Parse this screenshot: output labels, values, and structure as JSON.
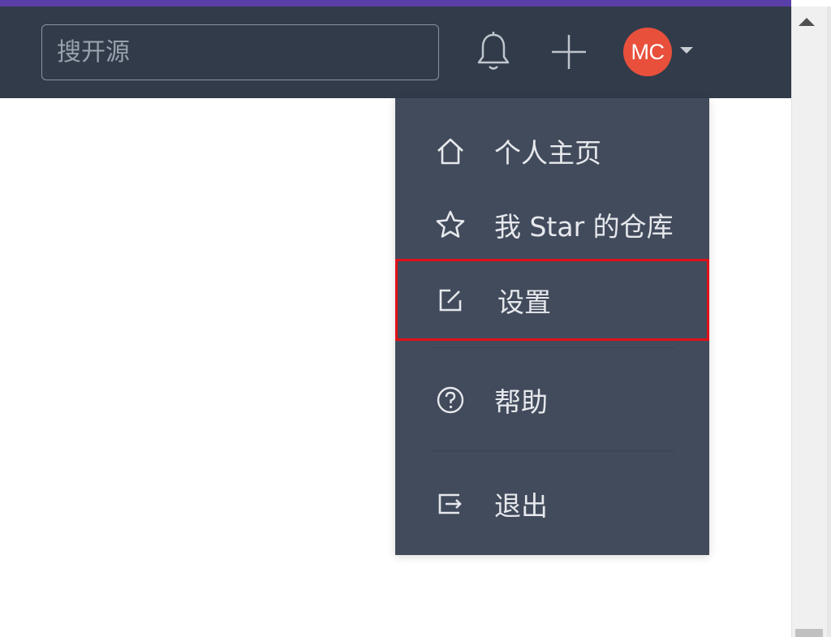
{
  "colors": {
    "header_bg": "#313b4a",
    "accent_bar": "#5b3fa8",
    "menu_bg": "#424b5c",
    "avatar_bg": "#e8503c",
    "highlight_border": "#e0101a"
  },
  "header": {
    "search": {
      "placeholder": "搜开源",
      "value": ""
    },
    "bell_icon": "bell-icon",
    "plus_icon": "plus-icon",
    "avatar": {
      "initials": "MC"
    }
  },
  "user_menu": {
    "items": [
      {
        "label": "个人主页",
        "icon": "home-icon"
      },
      {
        "label": "我 Star 的仓库",
        "icon": "star-icon"
      },
      {
        "label": "设置",
        "icon": "edit-icon",
        "highlighted": true
      },
      {
        "label": "帮助",
        "icon": "help-circle-icon"
      },
      {
        "label": "退出",
        "icon": "logout-icon"
      }
    ]
  }
}
